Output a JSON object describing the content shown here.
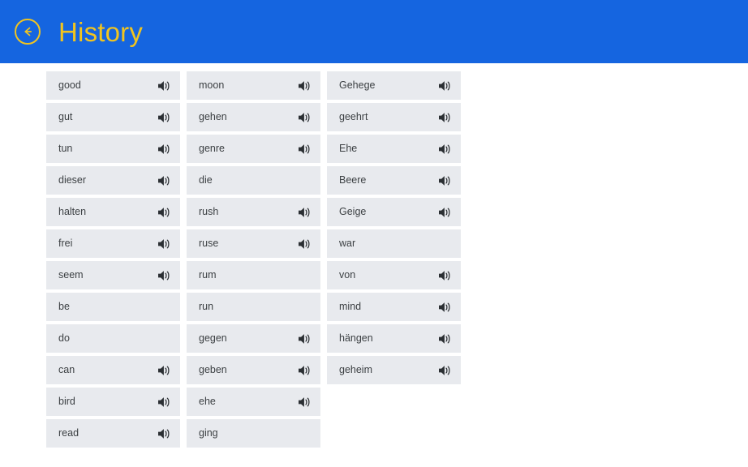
{
  "header": {
    "title": "History",
    "back_icon": "back-arrow-circle-icon",
    "background_color": "#1565e0",
    "accent_color": "#f0c420"
  },
  "theme": {
    "card_background": "#e8eaee",
    "card_text_color": "#3c4043",
    "page_background": "#ffffff"
  },
  "main": {
    "speaker_icon": "speaker-icon",
    "columns": [
      {
        "items": [
          {
            "word": "good",
            "has_audio": true
          },
          {
            "word": "gut",
            "has_audio": true
          },
          {
            "word": "tun",
            "has_audio": true
          },
          {
            "word": "dieser",
            "has_audio": true
          },
          {
            "word": "halten",
            "has_audio": true
          },
          {
            "word": "frei",
            "has_audio": true
          },
          {
            "word": "seem",
            "has_audio": true
          },
          {
            "word": "be",
            "has_audio": false
          },
          {
            "word": "do",
            "has_audio": false
          },
          {
            "word": "can",
            "has_audio": true
          },
          {
            "word": "bird",
            "has_audio": true
          },
          {
            "word": "read",
            "has_audio": true
          }
        ]
      },
      {
        "items": [
          {
            "word": "moon",
            "has_audio": true
          },
          {
            "word": "gehen",
            "has_audio": true
          },
          {
            "word": "genre",
            "has_audio": true
          },
          {
            "word": "die",
            "has_audio": false
          },
          {
            "word": "rush",
            "has_audio": true
          },
          {
            "word": "ruse",
            "has_audio": true
          },
          {
            "word": "rum",
            "has_audio": false
          },
          {
            "word": "run",
            "has_audio": false
          },
          {
            "word": "gegen",
            "has_audio": true
          },
          {
            "word": "geben",
            "has_audio": true
          },
          {
            "word": "ehe",
            "has_audio": true
          },
          {
            "word": "ging",
            "has_audio": false
          }
        ]
      },
      {
        "items": [
          {
            "word": "Gehege",
            "has_audio": true
          },
          {
            "word": "geehrt",
            "has_audio": true
          },
          {
            "word": "Ehe",
            "has_audio": true
          },
          {
            "word": "Beere",
            "has_audio": true
          },
          {
            "word": "Geige",
            "has_audio": true
          },
          {
            "word": "war",
            "has_audio": false
          },
          {
            "word": "von",
            "has_audio": true
          },
          {
            "word": "mind",
            "has_audio": true
          },
          {
            "word": "hängen",
            "has_audio": true
          },
          {
            "word": "geheim",
            "has_audio": true
          }
        ]
      }
    ]
  }
}
